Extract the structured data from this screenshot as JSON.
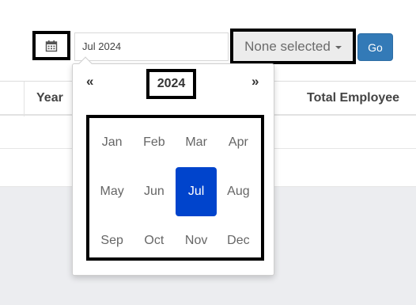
{
  "toolbar": {
    "calendar_icon": "calendar-icon",
    "date_value": "Jul 2024",
    "dropdown_label": "None selected",
    "dropdown_caret_icon": "caret-down-icon",
    "go_label": "Go",
    "go_color": "#337ab7"
  },
  "table": {
    "headers": [
      "Year",
      "Total Employee"
    ]
  },
  "datepicker": {
    "prev": "«",
    "next": "»",
    "year": "2024",
    "months": [
      "Jan",
      "Feb",
      "Mar",
      "Apr",
      "May",
      "Jun",
      "Jul",
      "Aug",
      "Sep",
      "Oct",
      "Nov",
      "Dec"
    ],
    "selected": "Jul",
    "selected_color": "#0044cc"
  }
}
